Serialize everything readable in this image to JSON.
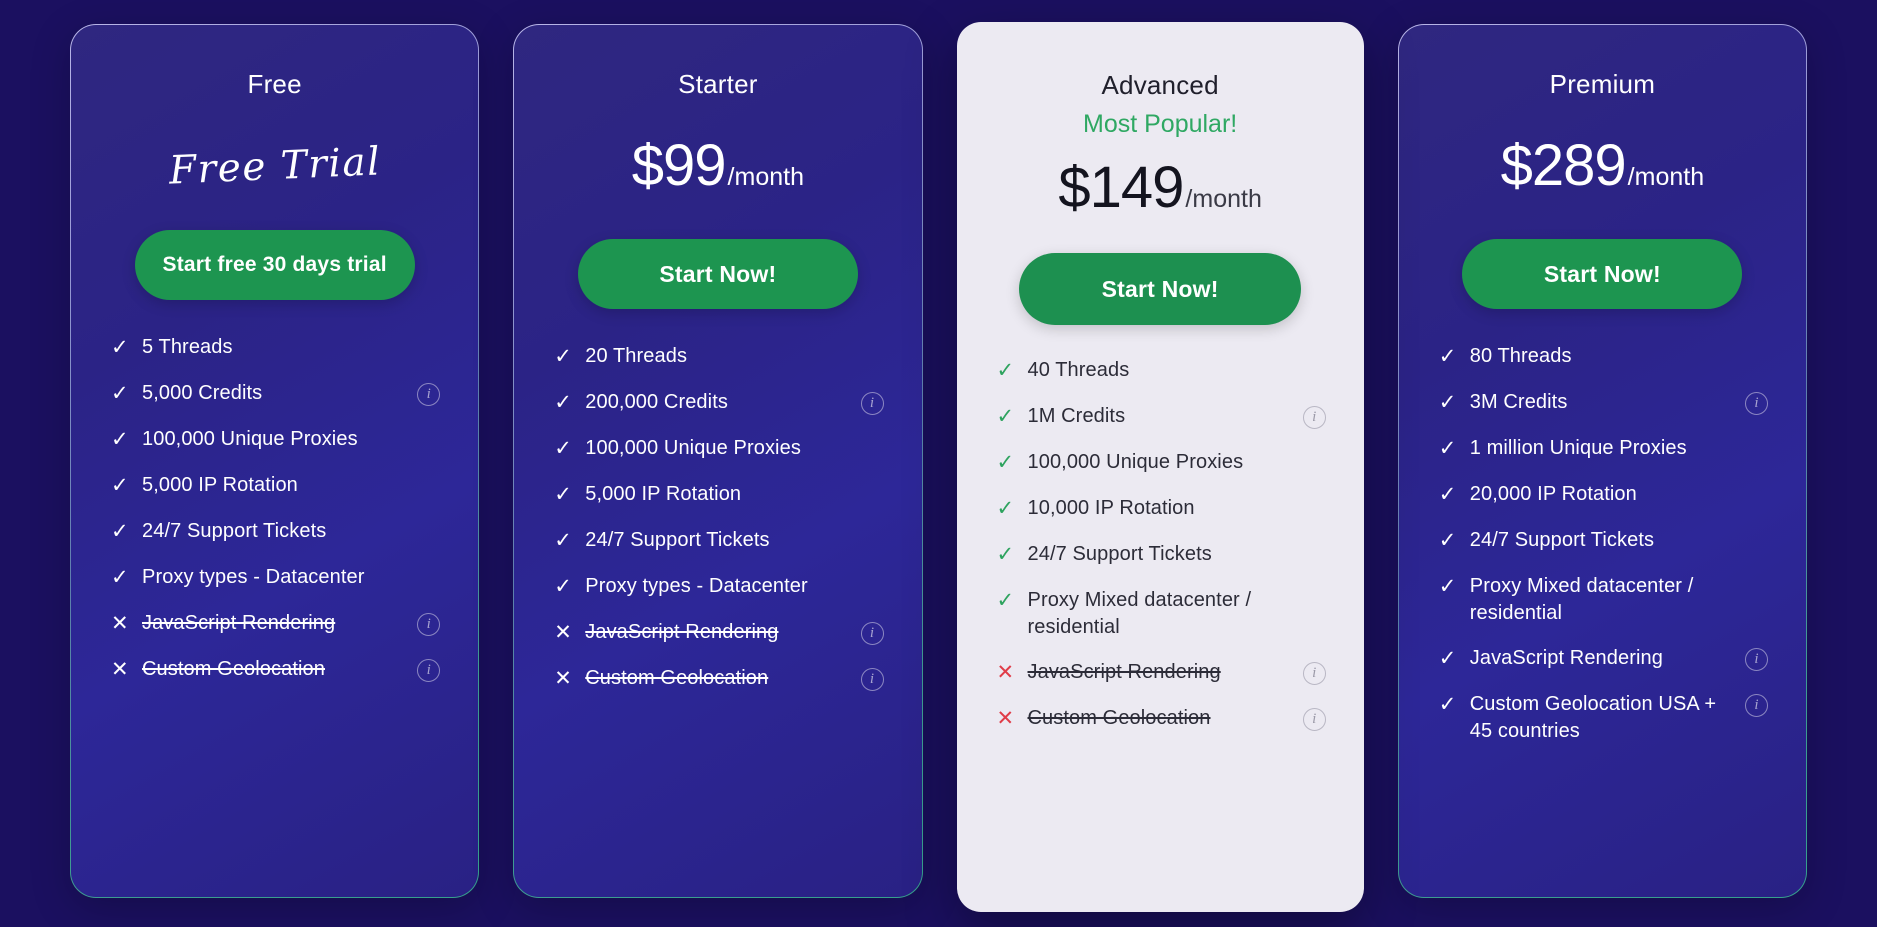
{
  "theme": {
    "page_background": "#1b1060",
    "card_background": "#2b2386",
    "featured_card_background": "#eceaf2",
    "cta_green": "#1d9550",
    "popular_green": "#2fa863",
    "cross_red": "#e03c48",
    "text_light": "#ffffff",
    "text_dark": "#2c2c38"
  },
  "icons": {
    "check": "✓",
    "cross": "✕",
    "info": "i"
  },
  "plans": [
    {
      "id": "free",
      "name": "Free",
      "featured": false,
      "script_label": "Free Trial",
      "price_amount": "",
      "price_period": "",
      "cta_label": "Start free 30 days trial",
      "features": [
        {
          "text": "5 Threads",
          "included": true,
          "info": false
        },
        {
          "text": "5,000 Credits",
          "included": true,
          "info": true
        },
        {
          "text": "100,000 Unique Proxies",
          "included": true,
          "info": false
        },
        {
          "text": "5,000 IP Rotation",
          "included": true,
          "info": false
        },
        {
          "text": "24/7 Support Tickets",
          "included": true,
          "info": false
        },
        {
          "text": "Proxy types - Datacenter",
          "included": true,
          "info": false
        },
        {
          "text": "JavaScript Rendering",
          "included": false,
          "info": true
        },
        {
          "text": "Custom Geolocation",
          "included": false,
          "info": true
        }
      ]
    },
    {
      "id": "starter",
      "name": "Starter",
      "featured": false,
      "script_label": "",
      "price_amount": "$99",
      "price_period": "/month",
      "cta_label": "Start Now!",
      "features": [
        {
          "text": "20 Threads",
          "included": true,
          "info": false
        },
        {
          "text": "200,000 Credits",
          "included": true,
          "info": true
        },
        {
          "text": "100,000 Unique Proxies",
          "included": true,
          "info": false
        },
        {
          "text": "5,000 IP Rotation",
          "included": true,
          "info": false
        },
        {
          "text": "24/7 Support Tickets",
          "included": true,
          "info": false
        },
        {
          "text": "Proxy types - Datacenter",
          "included": true,
          "info": false
        },
        {
          "text": "JavaScript Rendering",
          "included": false,
          "info": true
        },
        {
          "text": "Custom Geolocation",
          "included": false,
          "info": true
        }
      ]
    },
    {
      "id": "advanced",
      "name": "Advanced",
      "featured": true,
      "badge": "Most Popular!",
      "script_label": "",
      "price_amount": "$149",
      "price_period": "/month",
      "cta_label": "Start Now!",
      "features": [
        {
          "text": "40 Threads",
          "included": true,
          "info": false
        },
        {
          "text": "1M Credits",
          "included": true,
          "info": true
        },
        {
          "text": "100,000 Unique Proxies",
          "included": true,
          "info": false
        },
        {
          "text": "10,000 IP Rotation",
          "included": true,
          "info": false
        },
        {
          "text": "24/7 Support Tickets",
          "included": true,
          "info": false
        },
        {
          "text": "Proxy Mixed datacenter / residential",
          "included": true,
          "info": false
        },
        {
          "text": "JavaScript Rendering",
          "included": false,
          "info": true
        },
        {
          "text": "Custom Geolocation",
          "included": false,
          "info": true
        }
      ]
    },
    {
      "id": "premium",
      "name": "Premium",
      "featured": false,
      "script_label": "",
      "price_amount": "$289",
      "price_period": "/month",
      "cta_label": "Start Now!",
      "features": [
        {
          "text": "80 Threads",
          "included": true,
          "info": false
        },
        {
          "text": "3M Credits",
          "included": true,
          "info": true
        },
        {
          "text": "1 million Unique Proxies",
          "included": true,
          "info": false
        },
        {
          "text": "20,000 IP Rotation",
          "included": true,
          "info": false
        },
        {
          "text": "24/7 Support Tickets",
          "included": true,
          "info": false
        },
        {
          "text": "Proxy Mixed datacenter / residential",
          "included": true,
          "info": false
        },
        {
          "text": "JavaScript Rendering",
          "included": true,
          "info": true
        },
        {
          "text": "Custom Geolocation USA + 45 countries",
          "included": true,
          "info": true
        }
      ]
    }
  ]
}
